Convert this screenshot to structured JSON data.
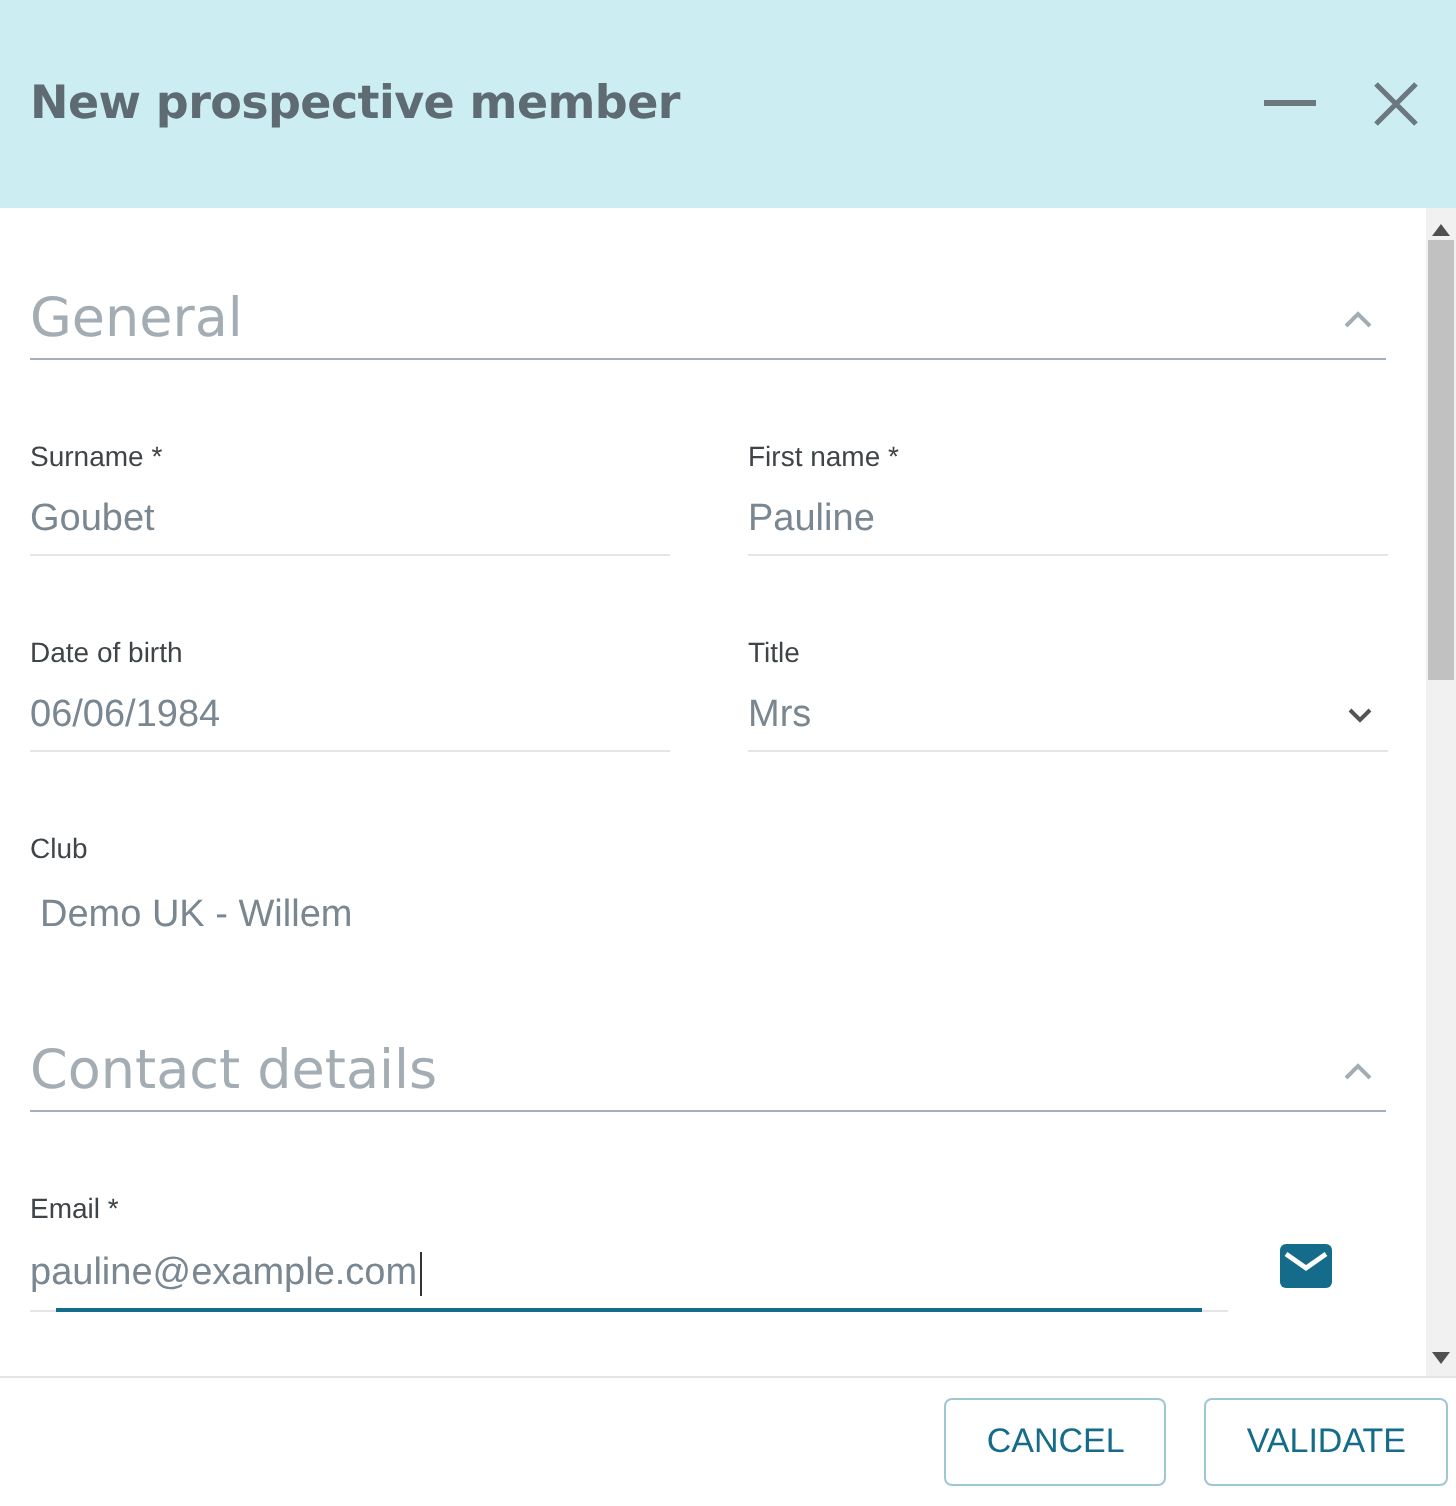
{
  "dialog": {
    "title": "New prospective member"
  },
  "sections": [
    {
      "title": "General",
      "expanded": true,
      "rows": [
        [
          {
            "label": "Surname *",
            "value": "Goubet",
            "kind": "text"
          },
          {
            "label": "First name *",
            "value": "Pauline",
            "kind": "text"
          }
        ],
        [
          {
            "label": "Date of birth",
            "value": "06/06/1984",
            "kind": "text"
          },
          {
            "label": "Title",
            "value": "Mrs",
            "kind": "select"
          }
        ],
        [
          {
            "label": "Club",
            "value": "Demo UK - Willem",
            "kind": "static"
          }
        ]
      ]
    },
    {
      "title": "Contact details",
      "expanded": true,
      "rows": [
        [
          {
            "label": "Email *",
            "value": "pauline@example.com",
            "kind": "email",
            "focused": true
          }
        ]
      ]
    }
  ],
  "buttons": [
    "CANCEL",
    "VALIDATE"
  ]
}
